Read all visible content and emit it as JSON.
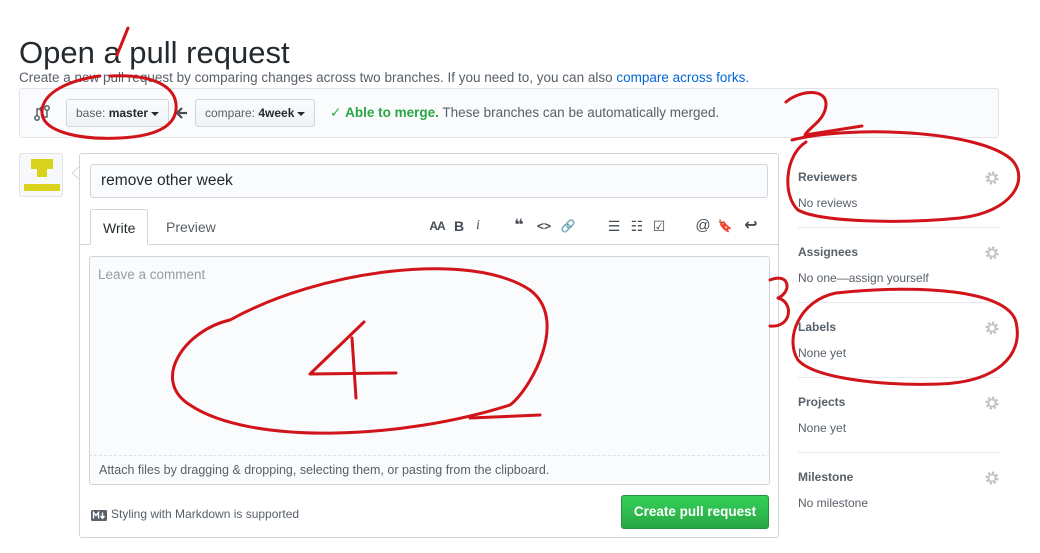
{
  "header": {
    "title": "Open a pull request",
    "subtitle": "Create a new pull request by comparing changes across two branches. If you need to, you can also ",
    "subtitle_link": "compare across forks."
  },
  "range": {
    "base_prefix": "base: ",
    "base_branch": "master",
    "compare_prefix": "compare: ",
    "compare_branch": "4week",
    "merge_status": "Able to merge.",
    "merge_detail": " These branches can be automatically merged."
  },
  "form": {
    "title_value": "remove other week",
    "tabs": {
      "write": "Write",
      "preview": "Preview"
    },
    "toolbar": {
      "heading": "AA",
      "bold": "B",
      "italic": "i",
      "quote": "❝",
      "code": "<>",
      "link": "🔗",
      "unordered_list": "☰",
      "ordered_list": "☷",
      "task_list": "☑",
      "mention": "@",
      "bookmark": "🔖",
      "reply": "↩"
    },
    "comment_placeholder": "Leave a comment",
    "attach_text": "Attach files by dragging & dropping, selecting them, or pasting from the clipboard.",
    "markdown_note": "Styling with Markdown is supported",
    "submit_label": "Create pull request"
  },
  "sidebar": {
    "sections": [
      {
        "title": "Reviewers",
        "value": "No reviews"
      },
      {
        "title": "Assignees",
        "value": "No one—assign yourself"
      },
      {
        "title": "Labels",
        "value": "None yet"
      },
      {
        "title": "Projects",
        "value": "None yet"
      },
      {
        "title": "Milestone",
        "value": "No milestone"
      }
    ]
  },
  "annotations": {
    "labels": [
      "1",
      "2",
      "3",
      "4"
    ],
    "color": "#d0141a"
  },
  "colors": {
    "link": "#0366d6",
    "merge_ok": "#28a745",
    "primary_button": "#28a745",
    "avatar": "#d9d31e"
  }
}
